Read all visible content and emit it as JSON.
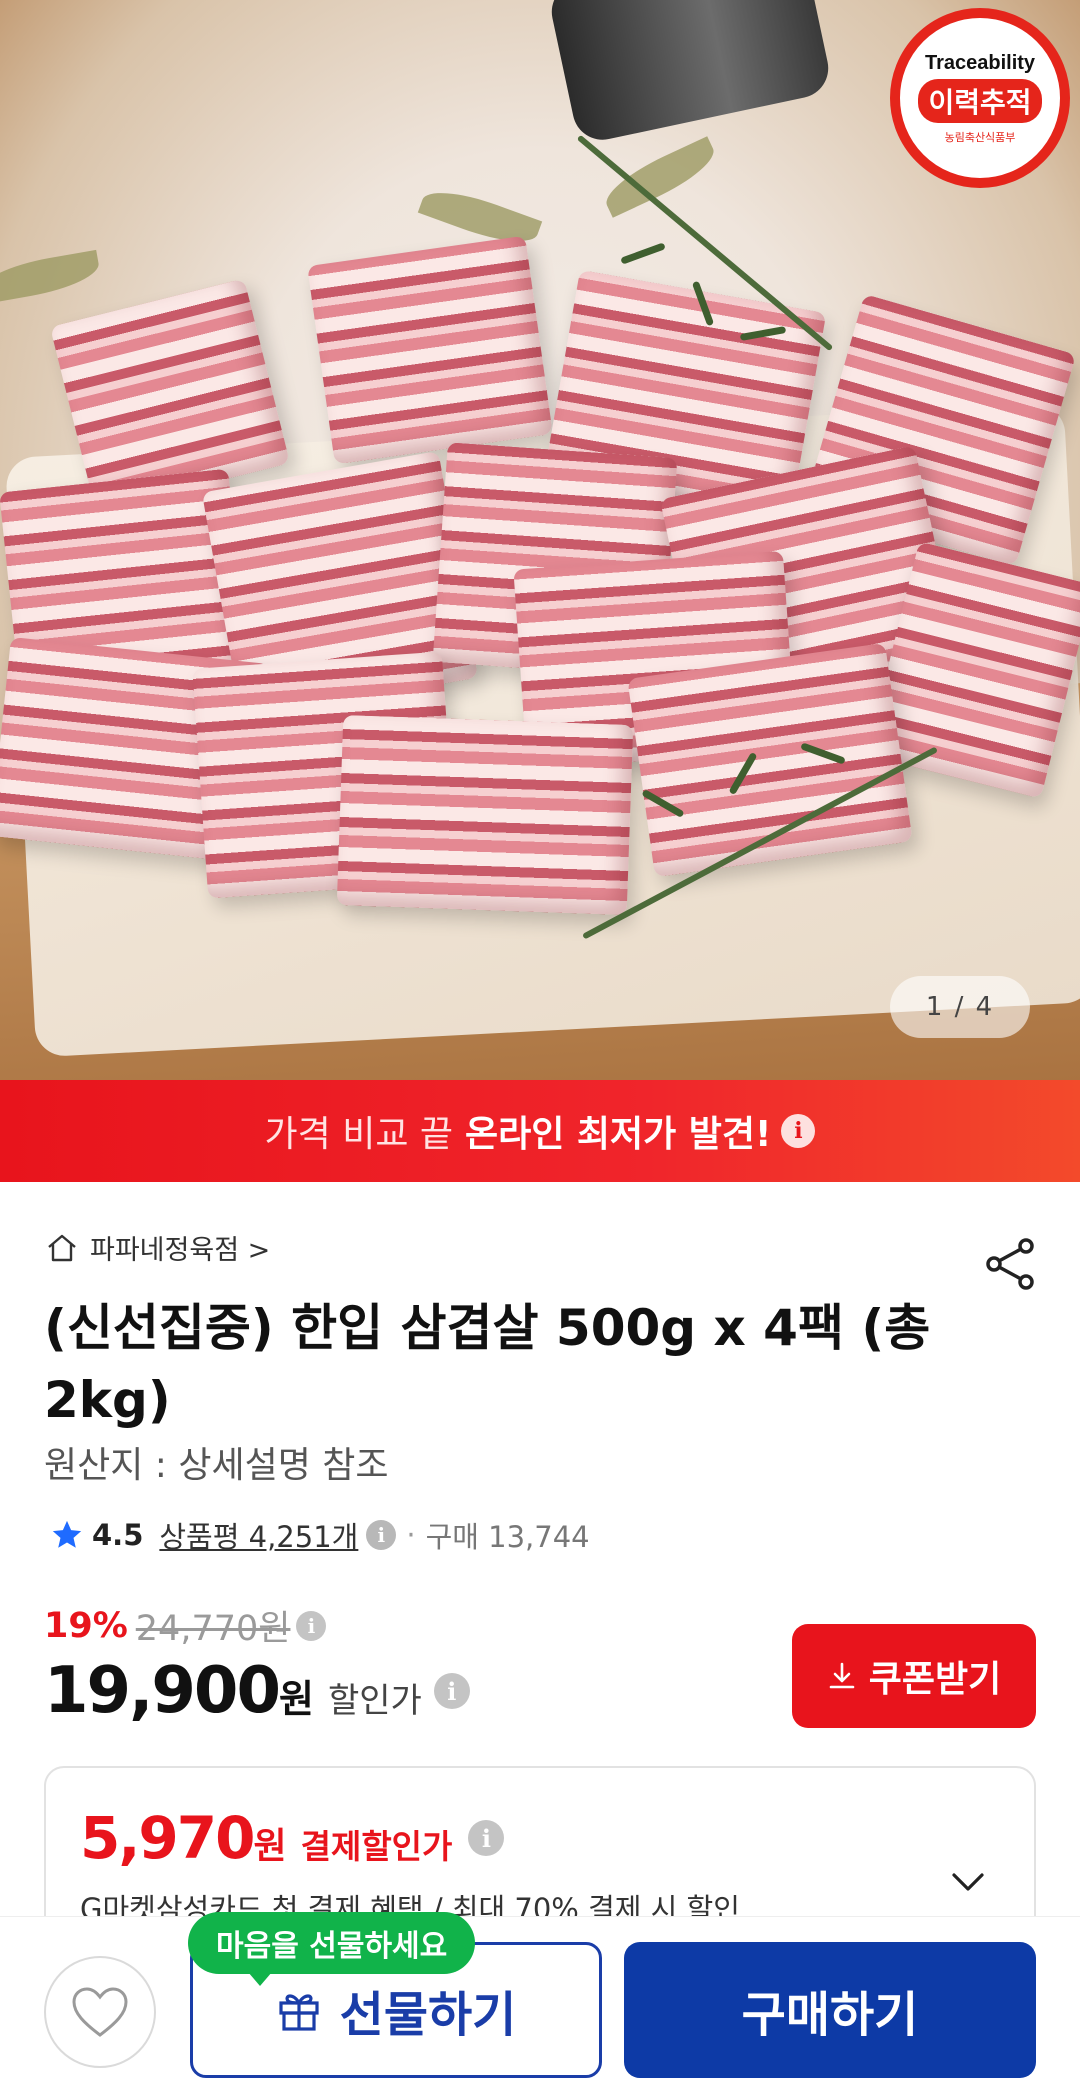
{
  "hero": {
    "badge": {
      "top": "Traceability",
      "main": "이력추적",
      "sub": "농림축산식품부"
    },
    "pager": "1 / 4"
  },
  "banner": {
    "normal_text": "가격 비교 끝",
    "bold_text": "온라인 최저가 발견!",
    "info": "i"
  },
  "product": {
    "store": "파파네정육점 >",
    "title": "(신선집중) 한입 삼겹살 500g x 4팩 (총 2kg)",
    "origin": "원산지 : 상세설명 참조",
    "rating": {
      "score": "4.5",
      "reviews": "상품평 4,251개",
      "separator": "·",
      "purchases": "구매 13,744"
    },
    "discount": {
      "percent": "19%",
      "original": "24,770원"
    },
    "price": {
      "value": "19,900",
      "unit": "원",
      "label": "할인가"
    },
    "coupon_button": "쿠폰받기"
  },
  "payment_card": {
    "amount": "5,970",
    "unit": "원",
    "label": "결제할인가",
    "desc": "G마켓삼성카드 첫 결제 혜택 / 최대 70% 결제 시 할인"
  },
  "bottom_bar": {
    "gift_tooltip": "마음을 선물하세요",
    "gift_button": "선물하기",
    "buy_button": "구매하기"
  },
  "colors": {
    "brand_red": "#e8141c",
    "brand_blue": "#0d3aa6",
    "gift_green": "#11b34a"
  }
}
